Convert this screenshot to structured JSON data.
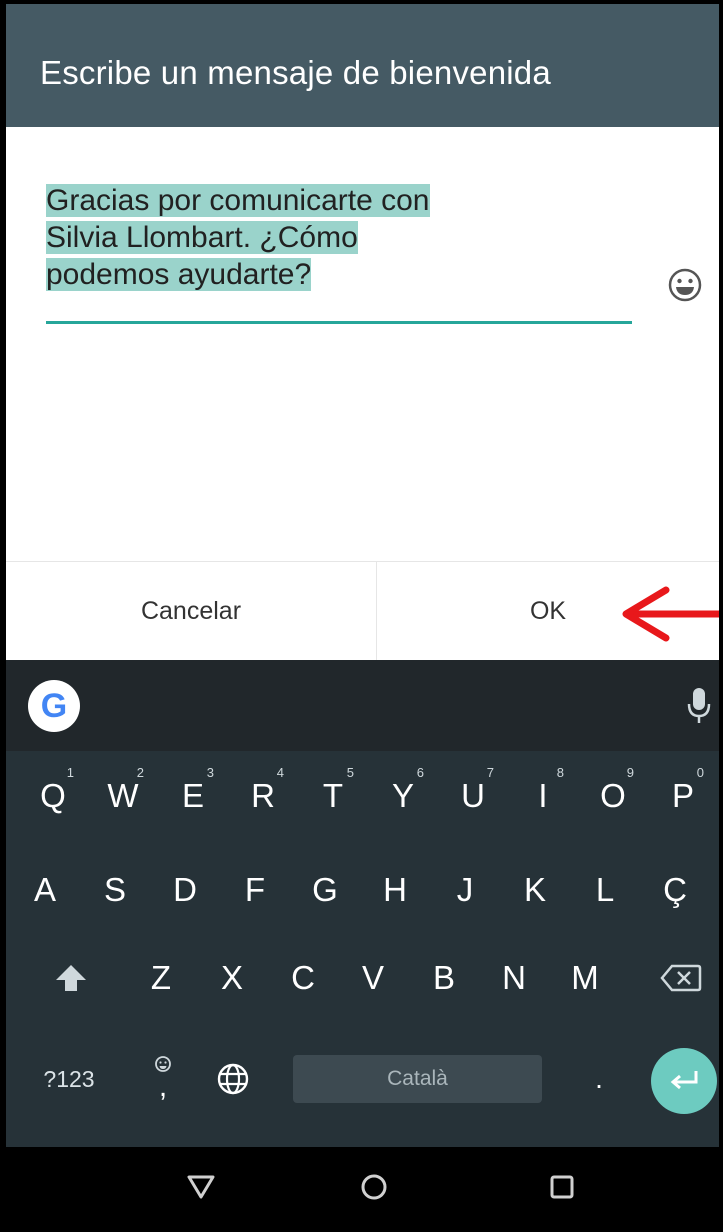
{
  "dialog": {
    "title": "Escribe un mensaje de bienvenida",
    "message_lines": [
      "Gracias por comunicarte con",
      "Silvia Llombart. ¿Cómo",
      "podemos ayudarte?"
    ],
    "emoji_icon": "smiley-icon",
    "cancel_label": "Cancelar",
    "ok_label": "OK"
  },
  "annotation": {
    "arrow_icon": "red-arrow-icon",
    "color": "#e8181b"
  },
  "keyboard": {
    "google_label": "G",
    "row1": [
      {
        "k": "Q",
        "h": "1"
      },
      {
        "k": "W",
        "h": "2"
      },
      {
        "k": "E",
        "h": "3"
      },
      {
        "k": "R",
        "h": "4"
      },
      {
        "k": "T",
        "h": "5"
      },
      {
        "k": "Y",
        "h": "6"
      },
      {
        "k": "U",
        "h": "7"
      },
      {
        "k": "I",
        "h": "8"
      },
      {
        "k": "O",
        "h": "9"
      },
      {
        "k": "P",
        "h": "0"
      }
    ],
    "row2": [
      "A",
      "S",
      "D",
      "F",
      "G",
      "H",
      "J",
      "K",
      "L",
      "Ç"
    ],
    "row3": [
      "Z",
      "X",
      "C",
      "V",
      "B",
      "N",
      "M"
    ],
    "symbols_label": "?123",
    "comma_label": ",",
    "space_label": "Català",
    "period_label": ".",
    "accent_color": "#6dcbc0"
  },
  "navbar": {
    "back_icon": "back-triangle-icon",
    "home_icon": "home-circle-icon",
    "recents_icon": "recents-square-icon"
  }
}
